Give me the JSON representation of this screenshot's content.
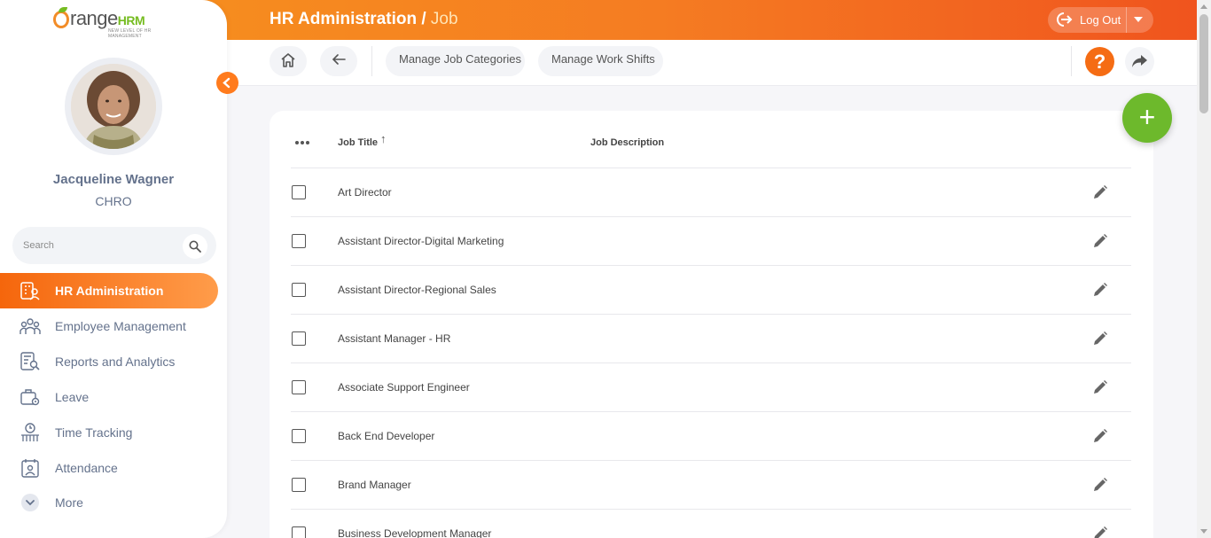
{
  "brand": {
    "logo_main": "range",
    "logo_suffix": "HRM",
    "logo_tagline": "NEW LEVEL OF HR MANAGEMENT"
  },
  "header": {
    "title": "HR Administration",
    "subtitle": "Job",
    "logout_label": "Log Out"
  },
  "user": {
    "name": "Jacqueline Wagner",
    "role": "CHRO"
  },
  "search": {
    "placeholder": "Search",
    "value": ""
  },
  "sidebar": {
    "items": [
      {
        "label": "HR Administration",
        "icon": "building-user-icon",
        "active": true
      },
      {
        "label": "Employee Management",
        "icon": "people-group-icon",
        "active": false
      },
      {
        "label": "Reports and Analytics",
        "icon": "report-search-icon",
        "active": false
      },
      {
        "label": "Leave",
        "icon": "briefcase-gear-icon",
        "active": false
      },
      {
        "label": "Time Tracking",
        "icon": "clock-people-icon",
        "active": false
      },
      {
        "label": "Attendance",
        "icon": "calendar-user-icon",
        "active": false
      },
      {
        "label": "More",
        "icon": "chevron-down-circle-icon",
        "active": false
      }
    ]
  },
  "toolbar": {
    "manage_job_categories": "Manage Job Categories",
    "manage_work_shifts": "Manage Work Shifts",
    "help_label": "?"
  },
  "table": {
    "columns": [
      "Job Title",
      "Job Description"
    ],
    "sort_indicator": "↑",
    "rows": [
      "Art Director",
      "Assistant Director-Digital Marketing",
      "Assistant Director-Regional Sales",
      "Assistant Manager - HR",
      "Associate Support Engineer",
      "Back End Developer",
      "Brand Manager",
      "Business Development Manager"
    ]
  },
  "colors": {
    "accent": "#f56c14",
    "add_button": "#6db92c",
    "nav_text": "#64728c"
  }
}
